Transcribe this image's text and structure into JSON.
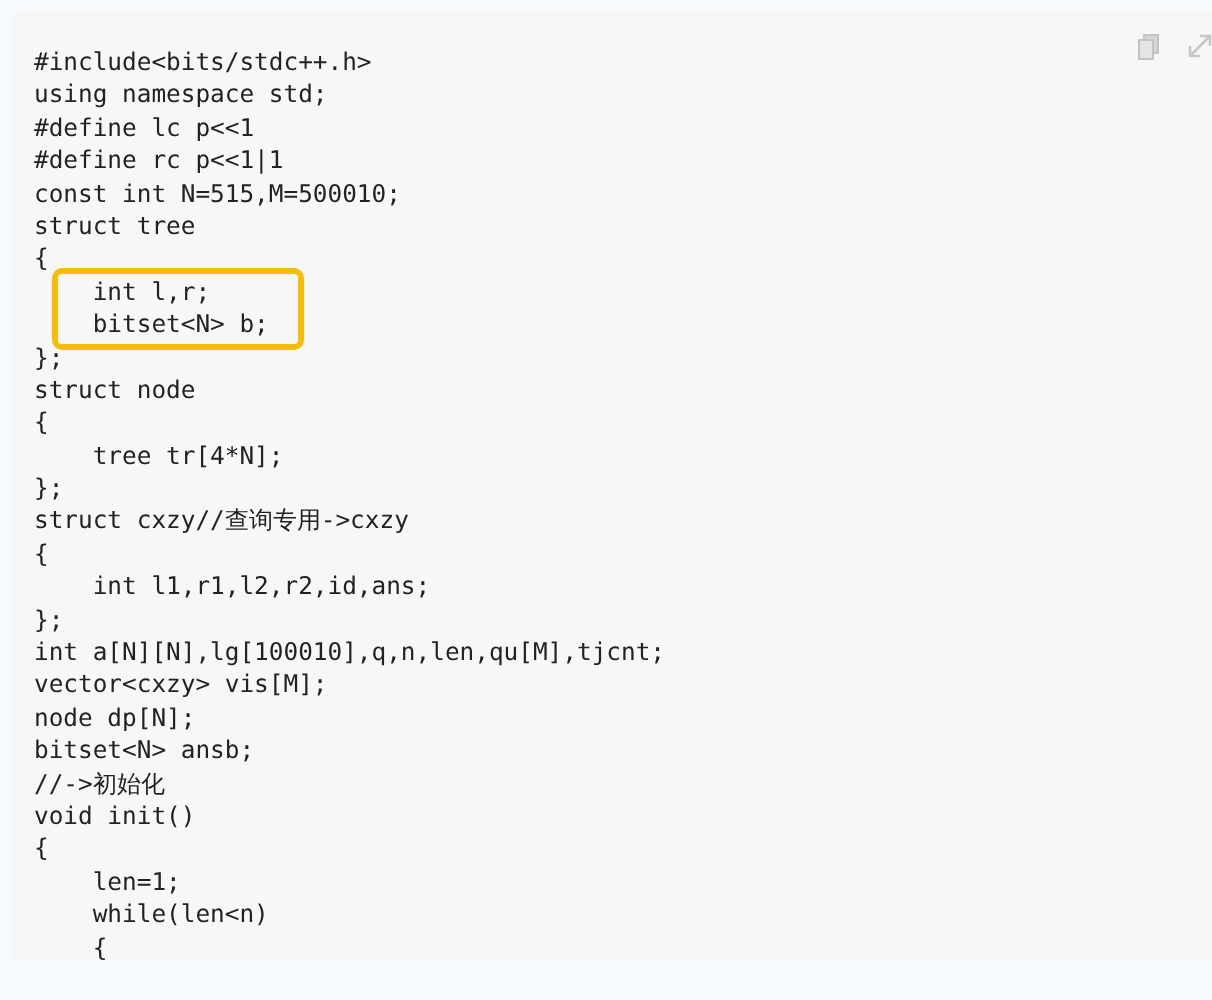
{
  "code_block": {
    "lines": [
      {
        "text": "#include<bits/stdc++.h>",
        "highlighted": false
      },
      {
        "text": "using namespace std;",
        "highlighted": false
      },
      {
        "text": "#define lc p<<1",
        "highlighted": false
      },
      {
        "text": "#define rc p<<1|1",
        "highlighted": false
      },
      {
        "text": "const int N=515,M=500010;",
        "highlighted": false
      },
      {
        "text": "struct tree",
        "highlighted": false
      },
      {
        "text": "{",
        "highlighted": false
      },
      {
        "text": "    int l,r;",
        "highlighted": true
      },
      {
        "text": "    bitset<N> b;",
        "highlighted": true
      },
      {
        "text": "};",
        "highlighted": false
      },
      {
        "text": "struct node",
        "highlighted": false
      },
      {
        "text": "{",
        "highlighted": false
      },
      {
        "text": "    tree tr[4*N];",
        "highlighted": false
      },
      {
        "text": "};",
        "highlighted": false
      },
      {
        "text": "struct cxzy//查询专用->cxzy",
        "highlighted": false
      },
      {
        "text": "{",
        "highlighted": false
      },
      {
        "text": "    int l1,r1,l2,r2,id,ans;",
        "highlighted": false
      },
      {
        "text": "};",
        "highlighted": false
      },
      {
        "text": "int a[N][N],lg[100010],q,n,len,qu[M],tjcnt;",
        "highlighted": false
      },
      {
        "text": "vector<cxzy> vis[M];",
        "highlighted": false
      },
      {
        "text": "node dp[N];",
        "highlighted": false
      },
      {
        "text": "bitset<N> ansb;",
        "highlighted": false
      },
      {
        "text": "//->初始化",
        "highlighted": false
      },
      {
        "text": "void init()",
        "highlighted": false
      },
      {
        "text": "{",
        "highlighted": false
      },
      {
        "text": "    len=1;",
        "highlighted": false
      },
      {
        "text": "    while(len<n)",
        "highlighted": false
      },
      {
        "text": "    {",
        "highlighted": false
      }
    ]
  }
}
